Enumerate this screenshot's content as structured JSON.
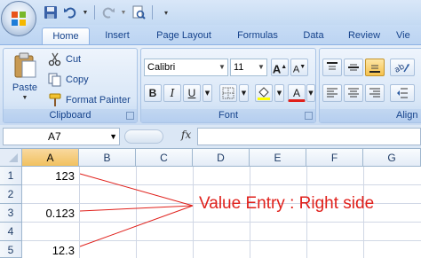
{
  "tabs": [
    "Home",
    "Insert",
    "Page Layout",
    "Formulas",
    "Data",
    "Review",
    "Vie"
  ],
  "clipboard": {
    "paste_label": "Paste",
    "cut_label": "Cut",
    "copy_label": "Copy",
    "format_painter_label": "Format Painter",
    "group_label": "Clipboard"
  },
  "font": {
    "font_name": "Calibri",
    "font_size": "11",
    "group_label": "Font",
    "bold": "B",
    "italic": "I",
    "underline": "U",
    "grow": "A",
    "shrink": "A",
    "color_letter": "A"
  },
  "alignment": {
    "group_label": "Align"
  },
  "formula_bar": {
    "name_box": "A7",
    "fx": "fx",
    "formula": ""
  },
  "sheet": {
    "columns": [
      "A",
      "B",
      "C",
      "D",
      "E",
      "F",
      "G"
    ],
    "rows": [
      "1",
      "2",
      "3",
      "4",
      "5"
    ],
    "cells": {
      "A1": "123",
      "A3": "0.123",
      "A5": "12.3"
    }
  },
  "annotation": {
    "text": "Value Entry : Right side",
    "color": "#e0201b"
  },
  "colors": {
    "accent": "#15428b",
    "selected_header": "#f1c15f",
    "ribbon": "#d9e6f6"
  }
}
